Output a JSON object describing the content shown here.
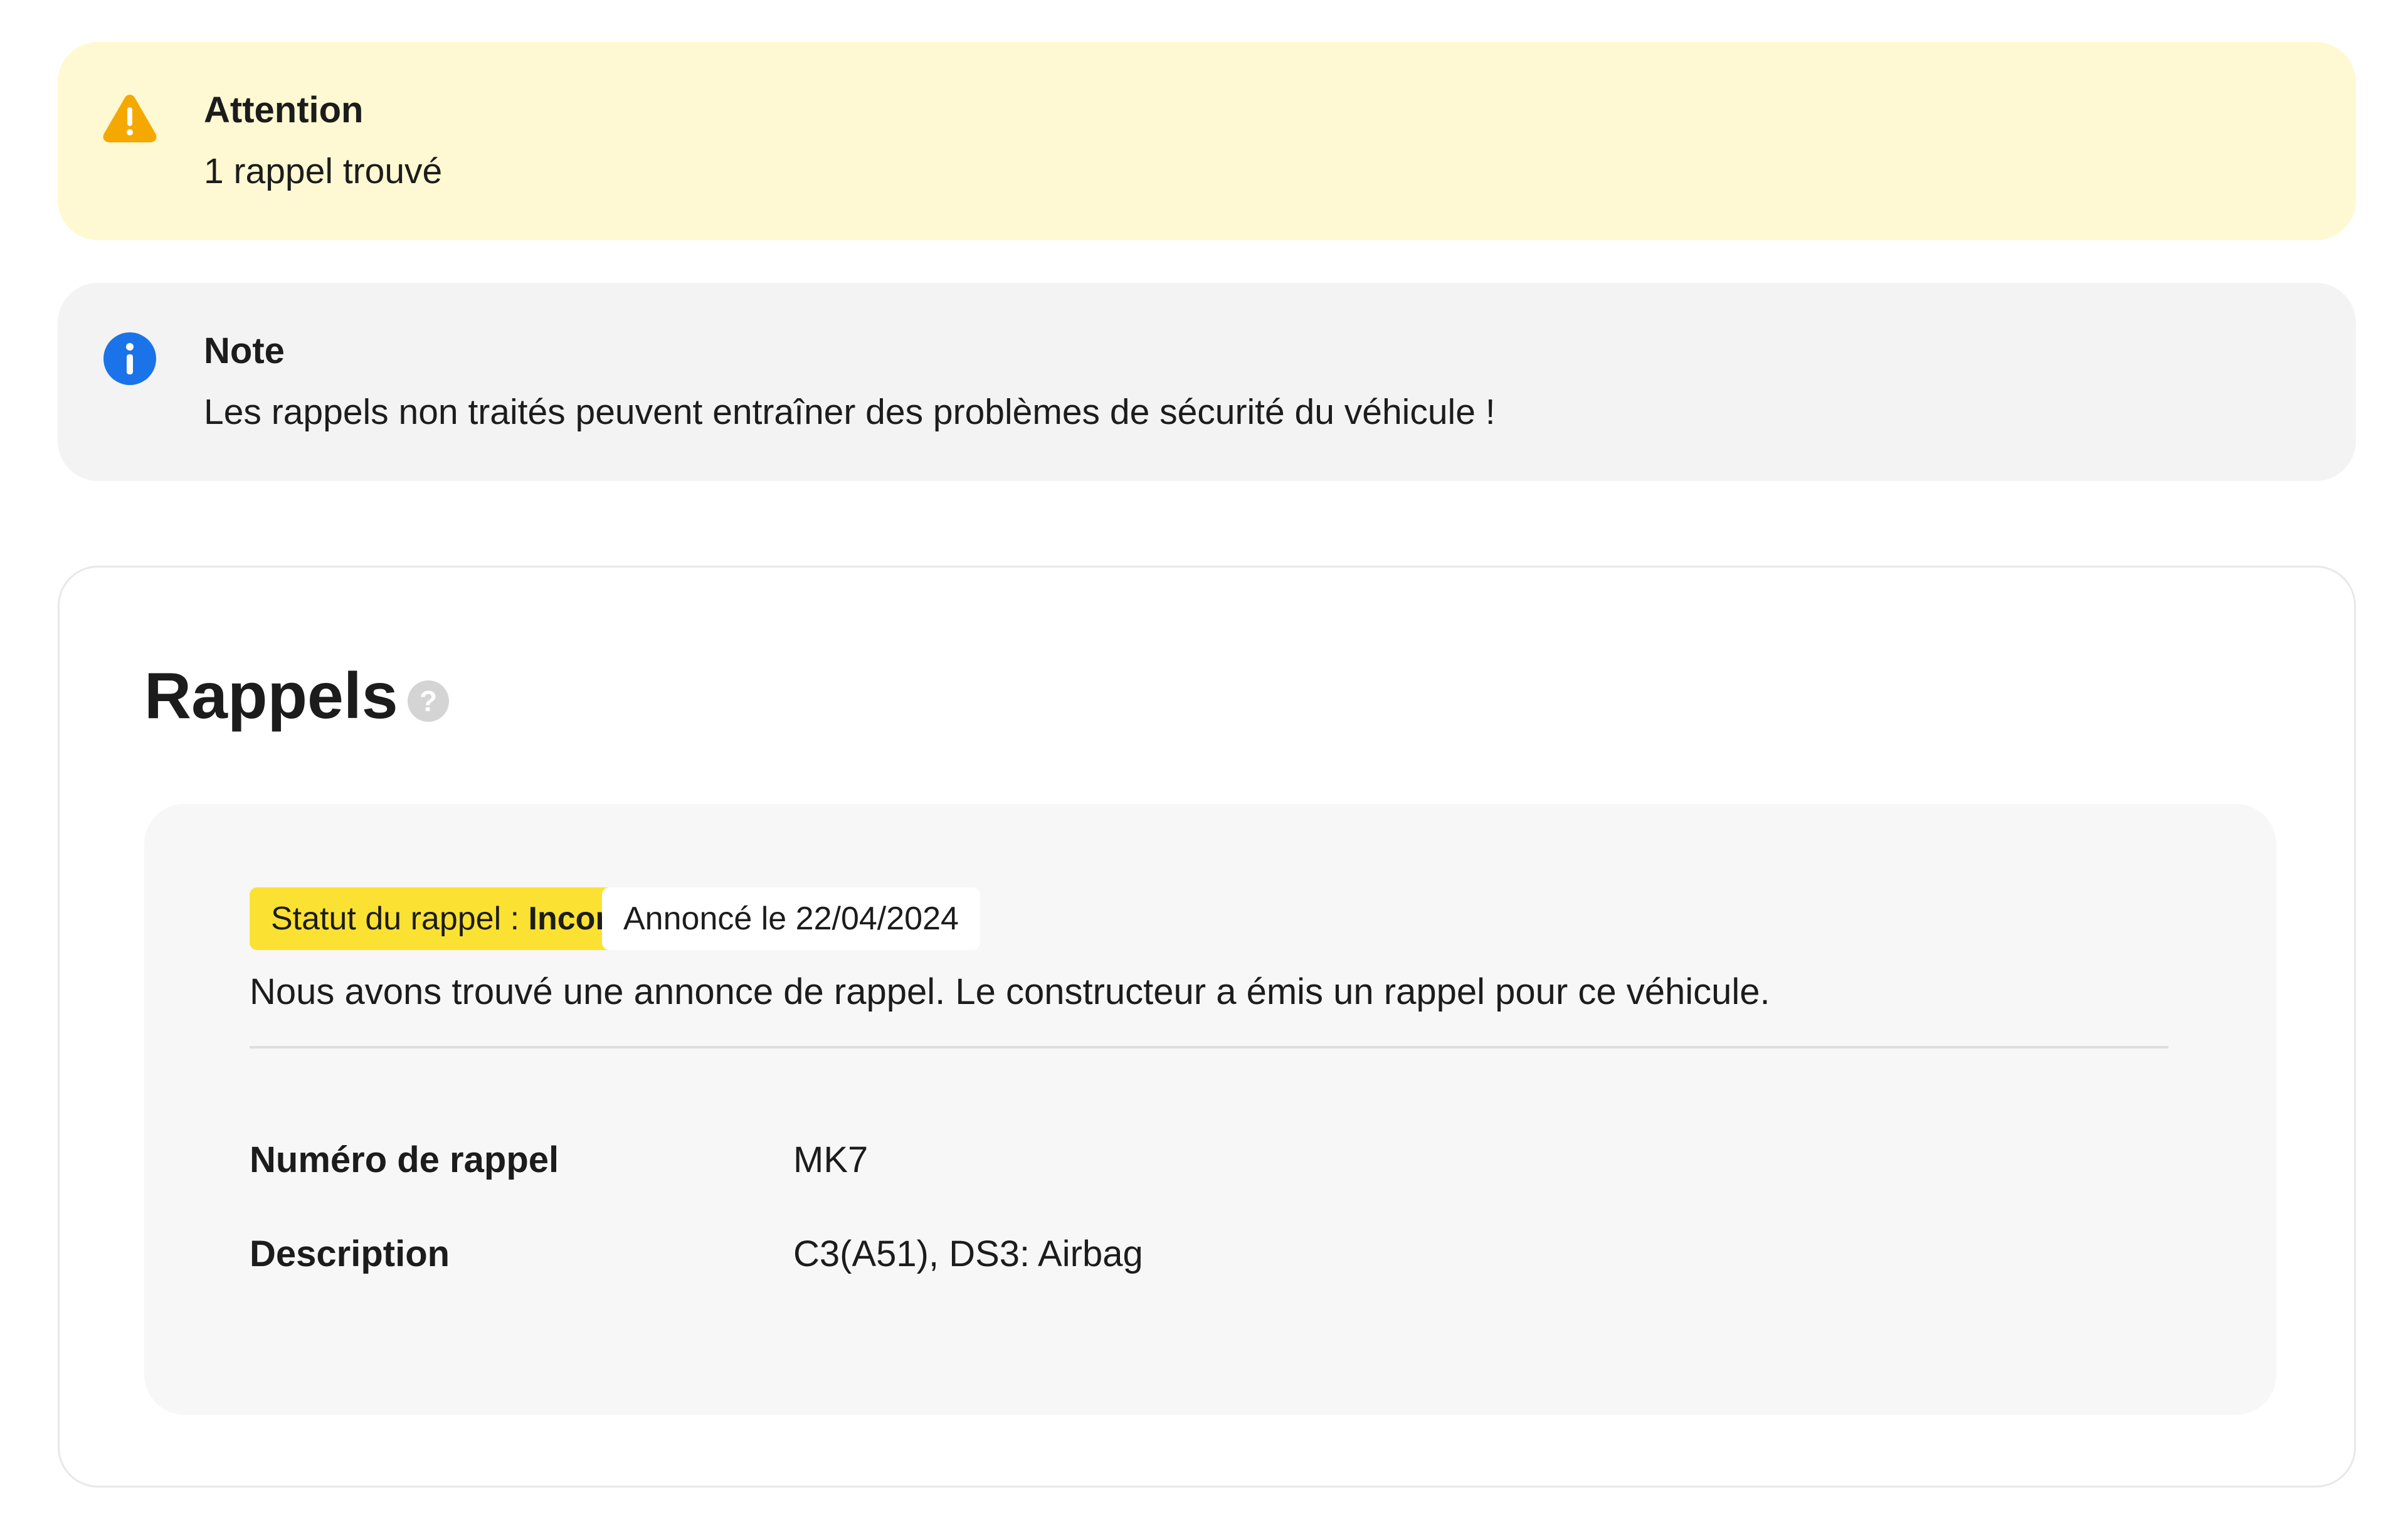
{
  "alerts": {
    "warning": {
      "icon": "warning-triangle-icon",
      "title": "Attention",
      "text": "1 rappel trouvé",
      "color": "#fef9d2",
      "icon_color": "#f5a800"
    },
    "info": {
      "icon": "info-circle-icon",
      "title": "Note",
      "text": "Les rappels non traités peuvent entraîner des problèmes de sécurité du véhicule !",
      "color": "#f3f3f3",
      "icon_color": "#1a73e8"
    }
  },
  "recalls": {
    "title": "Rappels",
    "help_icon": "help-question-icon",
    "help_glyph": "?",
    "item": {
      "status_label": "Statut du rappel : ",
      "status_value": "Inconnu",
      "status_color": "#fbe232",
      "announced": "Annoncé le 22/04/2024",
      "description": "Nous avons trouvé une annonce de rappel. Le constructeur a émis un rappel pour ce véhicule.",
      "details": [
        {
          "label": "Numéro de rappel",
          "value": "MK7"
        },
        {
          "label": "Description",
          "value": "C3(A51), DS3: Airbag"
        }
      ]
    }
  }
}
